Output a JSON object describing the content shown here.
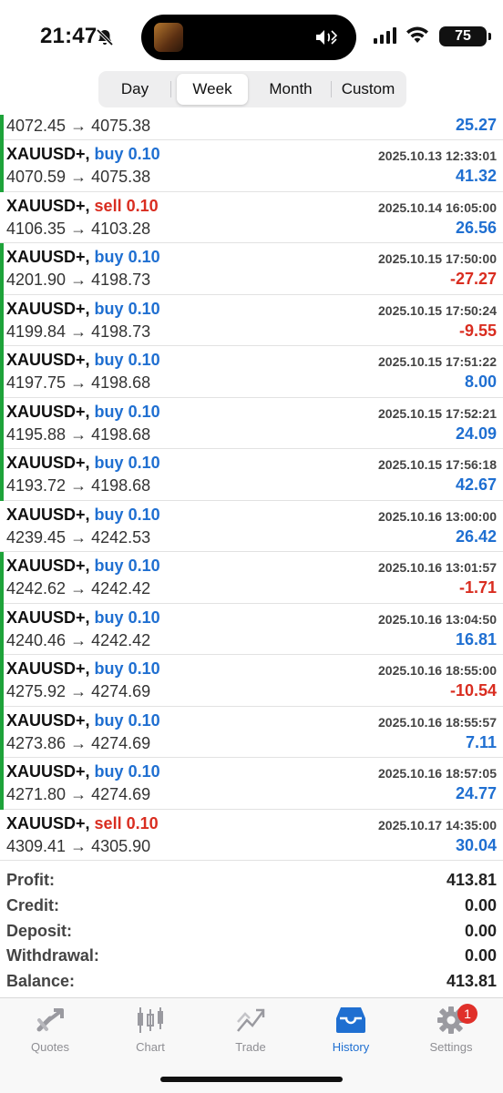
{
  "status_bar": {
    "time": "21:47",
    "battery": "75"
  },
  "period_tabs": [
    {
      "label": "Day",
      "active": false
    },
    {
      "label": "Week",
      "active": true
    },
    {
      "label": "Month",
      "active": false
    },
    {
      "label": "Custom",
      "active": false
    }
  ],
  "deals": [
    {
      "symbol": "",
      "side": "",
      "volume": "",
      "datetime": "",
      "prices": "4072.45 → 4075.38",
      "profit": "25.27",
      "profit_sign": "pos",
      "marker": true,
      "partial": true
    },
    {
      "symbol": "XAUUSD+,",
      "side": "buy",
      "volume": "0.10",
      "datetime": "2025.10.13 12:33:01",
      "prices": "4070.59 → 4075.38",
      "profit": "41.32",
      "profit_sign": "pos",
      "marker": true
    },
    {
      "symbol": "XAUUSD+,",
      "side": "sell",
      "volume": "0.10",
      "datetime": "2025.10.14 16:05:00",
      "prices": "4106.35 → 4103.28",
      "profit": "26.56",
      "profit_sign": "pos",
      "marker": false
    },
    {
      "symbol": "XAUUSD+,",
      "side": "buy",
      "volume": "0.10",
      "datetime": "2025.10.15 17:50:00",
      "prices": "4201.90 → 4198.73",
      "profit": "-27.27",
      "profit_sign": "neg",
      "marker": true
    },
    {
      "symbol": "XAUUSD+,",
      "side": "buy",
      "volume": "0.10",
      "datetime": "2025.10.15 17:50:24",
      "prices": "4199.84 → 4198.73",
      "profit": "-9.55",
      "profit_sign": "neg",
      "marker": true
    },
    {
      "symbol": "XAUUSD+,",
      "side": "buy",
      "volume": "0.10",
      "datetime": "2025.10.15 17:51:22",
      "prices": "4197.75 → 4198.68",
      "profit": "8.00",
      "profit_sign": "pos",
      "marker": true
    },
    {
      "symbol": "XAUUSD+,",
      "side": "buy",
      "volume": "0.10",
      "datetime": "2025.10.15 17:52:21",
      "prices": "4195.88 → 4198.68",
      "profit": "24.09",
      "profit_sign": "pos",
      "marker": true
    },
    {
      "symbol": "XAUUSD+,",
      "side": "buy",
      "volume": "0.10",
      "datetime": "2025.10.15 17:56:18",
      "prices": "4193.72 → 4198.68",
      "profit": "42.67",
      "profit_sign": "pos",
      "marker": true
    },
    {
      "symbol": "XAUUSD+,",
      "side": "buy",
      "volume": "0.10",
      "datetime": "2025.10.16 13:00:00",
      "prices": "4239.45 → 4242.53",
      "profit": "26.42",
      "profit_sign": "pos",
      "marker": false
    },
    {
      "symbol": "XAUUSD+,",
      "side": "buy",
      "volume": "0.10",
      "datetime": "2025.10.16 13:01:57",
      "prices": "4242.62 → 4242.42",
      "profit": "-1.71",
      "profit_sign": "neg",
      "marker": true
    },
    {
      "symbol": "XAUUSD+,",
      "side": "buy",
      "volume": "0.10",
      "datetime": "2025.10.16 13:04:50",
      "prices": "4240.46 → 4242.42",
      "profit": "16.81",
      "profit_sign": "pos",
      "marker": true
    },
    {
      "symbol": "XAUUSD+,",
      "side": "buy",
      "volume": "0.10",
      "datetime": "2025.10.16 18:55:00",
      "prices": "4275.92 → 4274.69",
      "profit": "-10.54",
      "profit_sign": "neg",
      "marker": true
    },
    {
      "symbol": "XAUUSD+,",
      "side": "buy",
      "volume": "0.10",
      "datetime": "2025.10.16 18:55:57",
      "prices": "4273.86 → 4274.69",
      "profit": "7.11",
      "profit_sign": "pos",
      "marker": true
    },
    {
      "symbol": "XAUUSD+,",
      "side": "buy",
      "volume": "0.10",
      "datetime": "2025.10.16 18:57:05",
      "prices": "4271.80 → 4274.69",
      "profit": "24.77",
      "profit_sign": "pos",
      "marker": true
    },
    {
      "symbol": "XAUUSD+,",
      "side": "sell",
      "volume": "0.10",
      "datetime": "2025.10.17 14:35:00",
      "prices": "4309.41 → 4305.90",
      "profit": "30.04",
      "profit_sign": "pos",
      "marker": false
    }
  ],
  "summary": [
    {
      "label": "Profit:",
      "value": "413.81"
    },
    {
      "label": "Credit:",
      "value": "0.00"
    },
    {
      "label": "Deposit:",
      "value": "0.00"
    },
    {
      "label": "Withdrawal:",
      "value": "0.00"
    },
    {
      "label": "Balance:",
      "value": "413.81"
    }
  ],
  "tabbar": [
    {
      "label": "Quotes",
      "icon": "quotes-icon",
      "active": false
    },
    {
      "label": "Chart",
      "icon": "chart-icon",
      "active": false
    },
    {
      "label": "Trade",
      "icon": "trade-icon",
      "active": false
    },
    {
      "label": "History",
      "icon": "history-icon",
      "active": true
    },
    {
      "label": "Settings",
      "icon": "settings-icon",
      "active": false,
      "badge": "1"
    }
  ],
  "colors": {
    "accent": "#1f6fd1",
    "loss": "#d92d20",
    "marker": "#1ea33a"
  }
}
